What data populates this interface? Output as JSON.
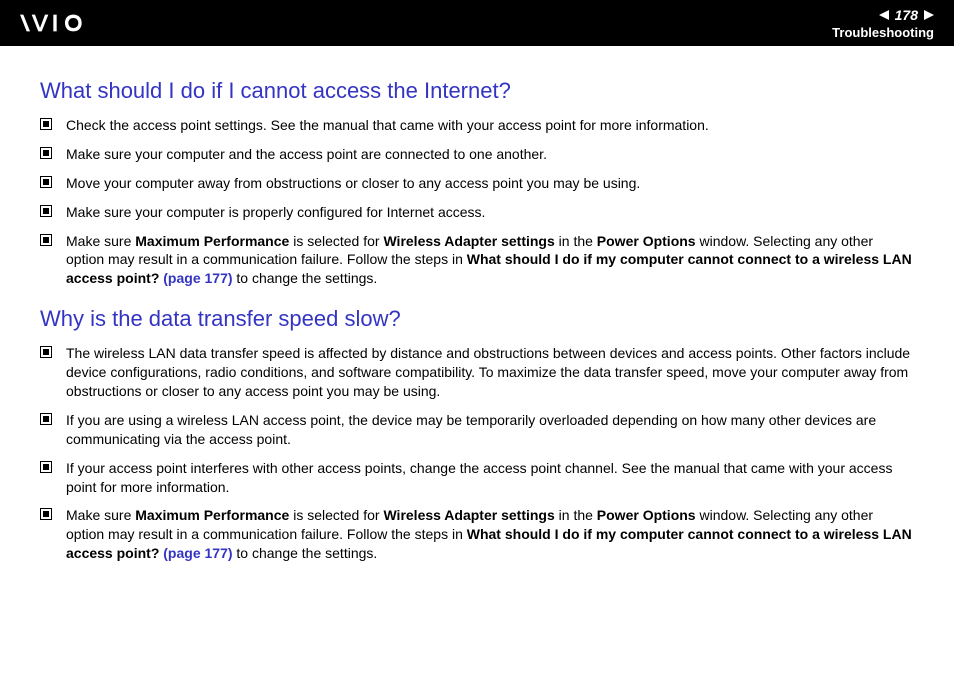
{
  "header": {
    "page_number": "178",
    "section": "Troubleshooting",
    "logo_alt": "VAIO"
  },
  "sections": [
    {
      "title": "What should I do if I cannot access the Internet?",
      "items": [
        [
          {
            "t": "Check the access point settings. See the manual that came with your access point for more information."
          }
        ],
        [
          {
            "t": "Make sure your computer and the access point are connected to one another."
          }
        ],
        [
          {
            "t": "Move your computer away from obstructions or closer to any access point you may be using."
          }
        ],
        [
          {
            "t": "Make sure your computer is properly configured for Internet access."
          }
        ],
        [
          {
            "t": "Make sure "
          },
          {
            "t": "Maximum Performance",
            "b": true
          },
          {
            "t": " is selected for "
          },
          {
            "t": "Wireless Adapter settings",
            "b": true
          },
          {
            "t": " in the "
          },
          {
            "t": "Power Options",
            "b": true
          },
          {
            "t": " window. Selecting any other option may result in a communication failure. Follow the steps in "
          },
          {
            "t": "What should I do if my computer cannot connect to a wireless LAN access point? ",
            "b": true
          },
          {
            "t": "(page 177)",
            "link": true
          },
          {
            "t": " to change the settings."
          }
        ]
      ]
    },
    {
      "title": "Why is the data transfer speed slow?",
      "items": [
        [
          {
            "t": "The wireless LAN data transfer speed is affected by distance and obstructions between devices and access points. Other factors include device configurations, radio conditions, and software compatibility. To maximize the data transfer speed, move your computer away from obstructions or closer to any access point you may be using."
          }
        ],
        [
          {
            "t": "If you are using a wireless LAN access point, the device may be temporarily overloaded depending on how many other devices are communicating via the access point."
          }
        ],
        [
          {
            "t": "If your access point interferes with other access points, change the access point channel. See the manual that came with your access point for more information."
          }
        ],
        [
          {
            "t": "Make sure "
          },
          {
            "t": "Maximum Performance",
            "b": true
          },
          {
            "t": " is selected for "
          },
          {
            "t": "Wireless Adapter settings",
            "b": true
          },
          {
            "t": " in the "
          },
          {
            "t": "Power Options",
            "b": true
          },
          {
            "t": " window. Selecting any other option may result in a communication failure. Follow the steps in "
          },
          {
            "t": "What should I do if my computer cannot connect to a wireless LAN access point? ",
            "b": true
          },
          {
            "t": "(page 177)",
            "link": true
          },
          {
            "t": " to change the settings."
          }
        ]
      ]
    }
  ]
}
